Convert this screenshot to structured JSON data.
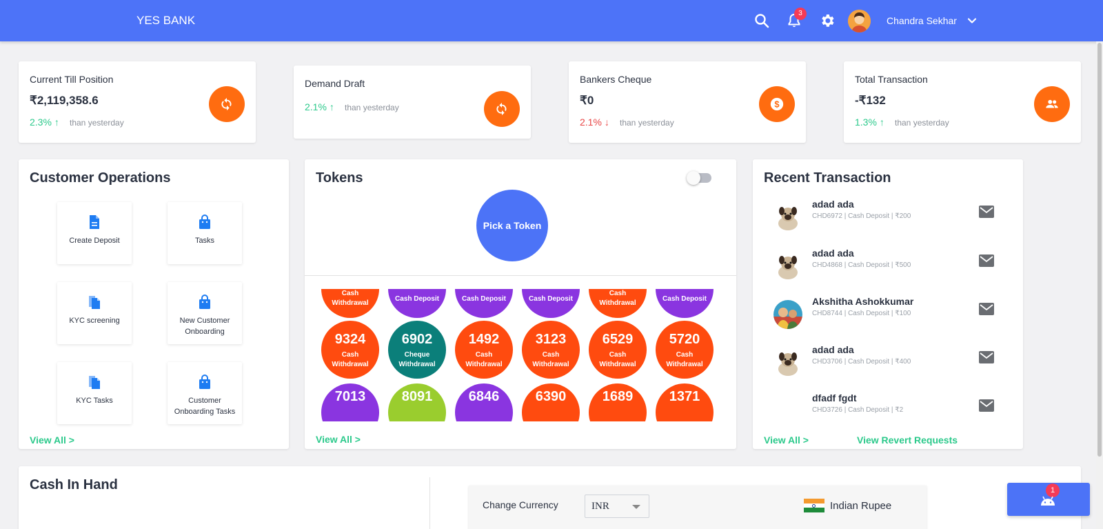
{
  "header": {
    "brand": "YES BANK",
    "notification_count": "3",
    "user_name": "Chandra Sekhar"
  },
  "stats": [
    {
      "title": "Current Till Position",
      "value": "₹2,119,358.6",
      "pct": "2.3%",
      "trend": "up",
      "compare": "than yesterday",
      "icon": "refresh-icon"
    },
    {
      "title": "Demand Draft",
      "value": "",
      "pct": "2.1%",
      "trend": "up",
      "compare": "than yesterday",
      "icon": "refresh-icon"
    },
    {
      "title": "Bankers Cheque",
      "value": "₹0",
      "pct": "2.1%",
      "trend": "down",
      "compare": "than yesterday",
      "icon": "dollar-icon"
    },
    {
      "title": "Total Transaction",
      "value": "-₹132",
      "pct": "1.3%",
      "trend": "up",
      "compare": "than yesterday",
      "icon": "people-icon"
    }
  ],
  "customer_operations": {
    "title": "Customer Operations",
    "items": [
      {
        "label": "Create Deposit",
        "icon": "document-icon"
      },
      {
        "label": "Tasks",
        "icon": "bag-icon"
      },
      {
        "label": "KYC screening",
        "icon": "copy-icon"
      },
      {
        "label": "New Customer Onboarding",
        "icon": "bag-icon"
      },
      {
        "label": "KYC Tasks",
        "icon": "copy-icon"
      },
      {
        "label": "Customer Onboarding Tasks",
        "icon": "bag-icon"
      }
    ],
    "view_all": "View All >"
  },
  "tokens": {
    "title": "Tokens",
    "pick_label": "Pick a Token",
    "view_all": "View All >",
    "rows": [
      [
        {
          "number": "",
          "type": "Cash Withdrawal",
          "color": "#ff4b0f"
        },
        {
          "number": "",
          "type": "Cash Deposit",
          "color": "#8a35e0"
        },
        {
          "number": "",
          "type": "Cash Deposit",
          "color": "#8a35e0"
        },
        {
          "number": "",
          "type": "Cash Deposit",
          "color": "#8a35e0"
        },
        {
          "number": "",
          "type": "Cash Withdrawal",
          "color": "#ff4b0f"
        },
        {
          "number": "",
          "type": "Cash Deposit",
          "color": "#8a35e0"
        }
      ],
      [
        {
          "number": "9324",
          "type": "Cash Withdrawal",
          "color": "#ff4b0f"
        },
        {
          "number": "6902",
          "type": "Cheque Withdrawal",
          "color": "#0b7f7a"
        },
        {
          "number": "1492",
          "type": "Cash Withdrawal",
          "color": "#ff4b0f"
        },
        {
          "number": "3123",
          "type": "Cash Withdrawal",
          "color": "#ff4b0f"
        },
        {
          "number": "6529",
          "type": "Cash Withdrawal",
          "color": "#ff4b0f"
        },
        {
          "number": "5720",
          "type": "Cash Withdrawal",
          "color": "#ff4b0f"
        }
      ],
      [
        {
          "number": "7013",
          "type": "",
          "color": "#8a35e0"
        },
        {
          "number": "8091",
          "type": "",
          "color": "#9acd2e"
        },
        {
          "number": "6846",
          "type": "",
          "color": "#8a35e0"
        },
        {
          "number": "6390",
          "type": "",
          "color": "#ff4b0f"
        },
        {
          "number": "1689",
          "type": "",
          "color": "#ff4b0f"
        },
        {
          "number": "1371",
          "type": "",
          "color": "#ff4b0f"
        }
      ]
    ]
  },
  "recent_transactions": {
    "title": "Recent Transaction",
    "items": [
      {
        "name": "adad ada",
        "detail": "CHD6972 | Cash Deposit | ₹200",
        "avatar": "dog"
      },
      {
        "name": "adad ada",
        "detail": "CHD4868 | Cash Deposit | ₹500",
        "avatar": "dog"
      },
      {
        "name": "Akshitha Ashokkumar",
        "detail": "CHD8744 | Cash Deposit | ₹100",
        "avatar": "photo"
      },
      {
        "name": "adad ada",
        "detail": "CHD3706 | Cash Deposit | ₹400",
        "avatar": "dog"
      },
      {
        "name": "dfadf fgdt",
        "detail": "CHD3726 | Cash Deposit | ₹2",
        "avatar": "none"
      }
    ],
    "view_all": "View All >",
    "view_revert": "View Revert Requests"
  },
  "cash_in_hand": {
    "title": "Cash In Hand",
    "change_currency_label": "Change Currency",
    "currency_code": "INR",
    "currency_name": "Indian Rupee"
  },
  "fab": {
    "badge": "1",
    "icon": "android-icon"
  },
  "colors": {
    "primary": "#4d73f8",
    "accent": "#ff6c10",
    "positive": "#2bc98b",
    "negative": "#e84545"
  }
}
